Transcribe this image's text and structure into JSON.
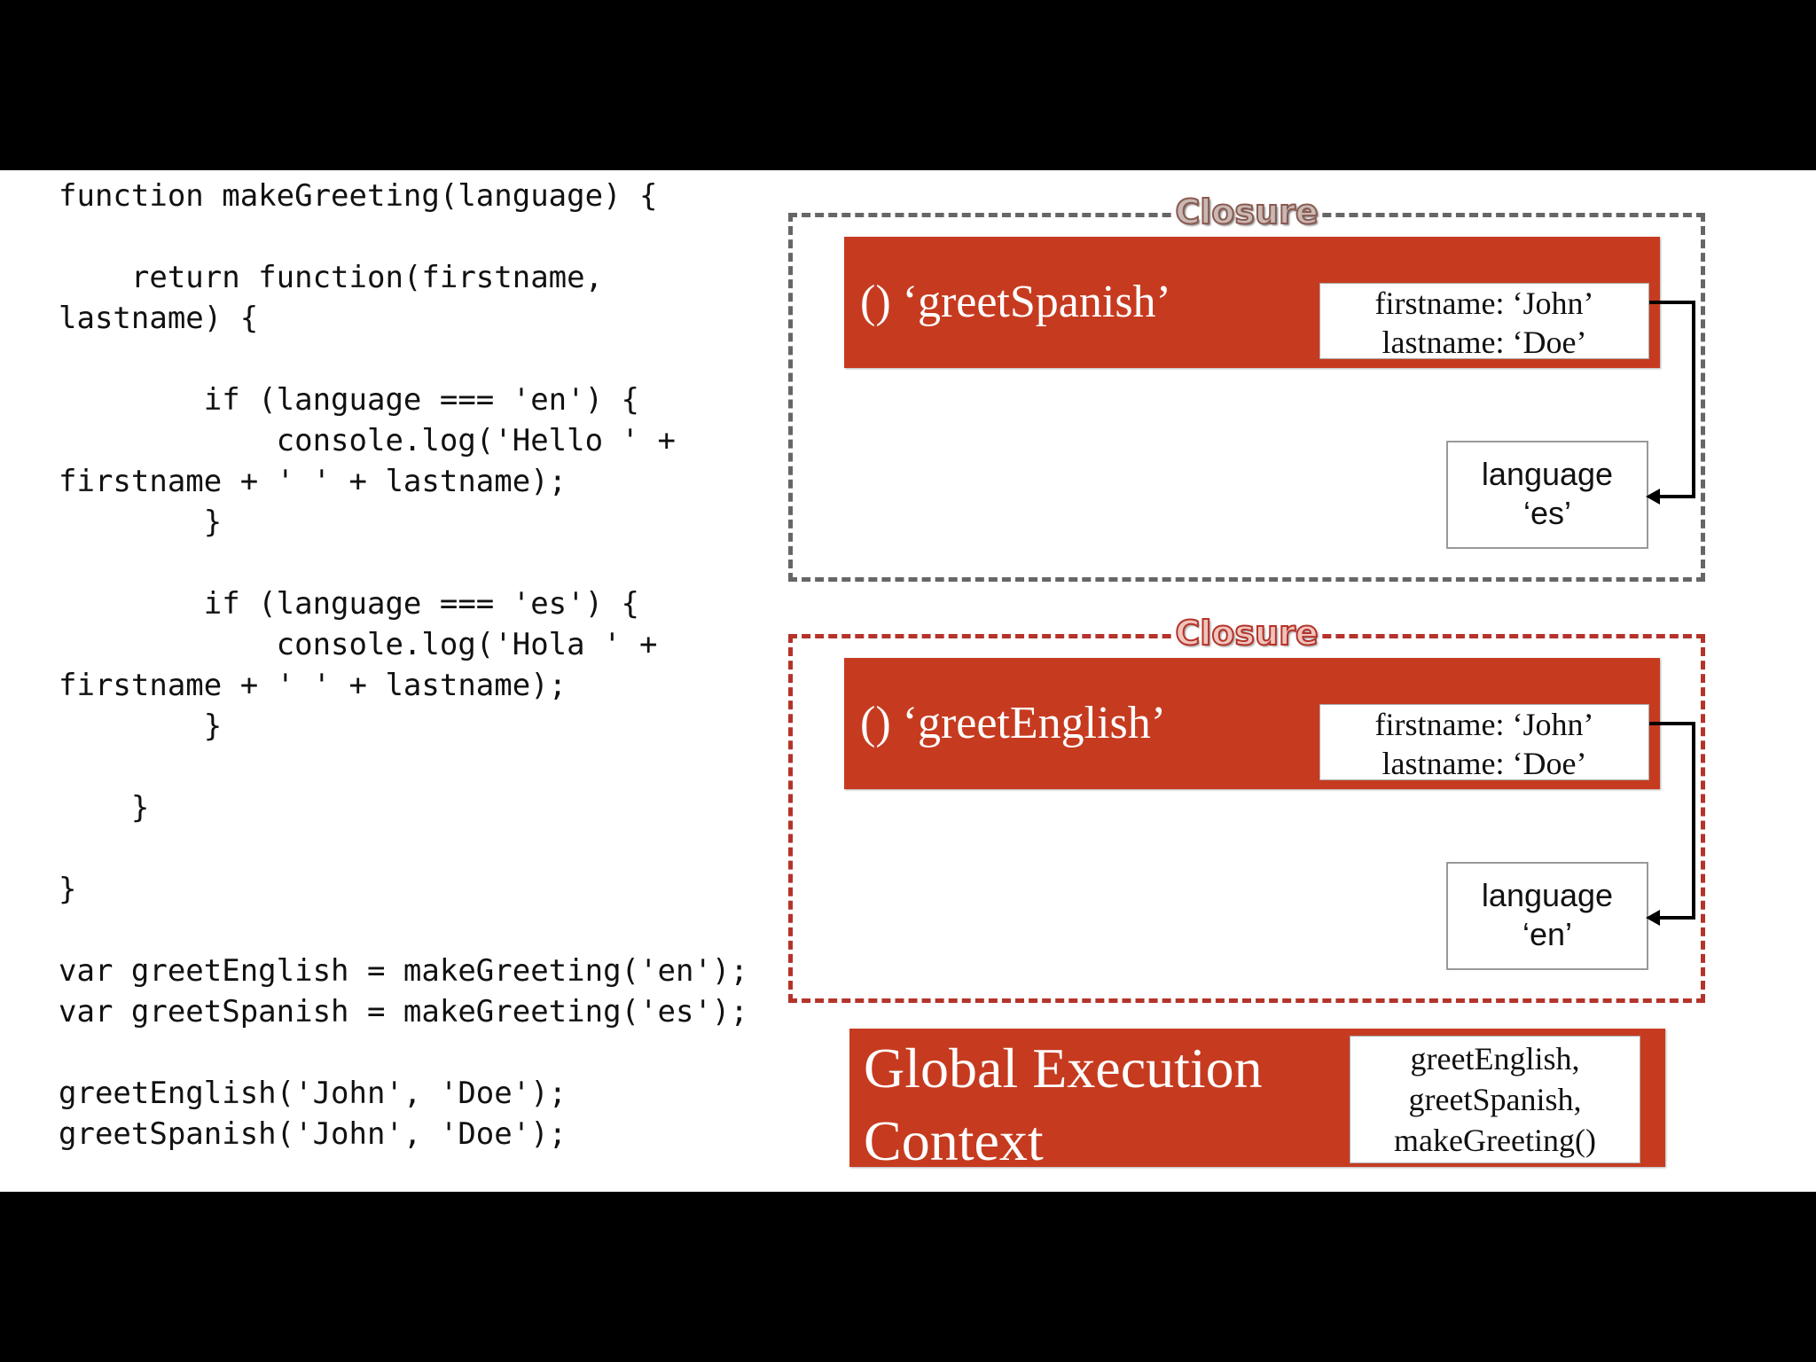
{
  "code": [
    "function makeGreeting(language) {",
    "",
    "    return function(firstname,",
    "lastname) {",
    "",
    "        if (language === 'en') {",
    "            console.log('Hello ' +",
    "firstname + ' ' + lastname);",
    "        }",
    "",
    "        if (language === 'es') {",
    "            console.log('Hola ' +",
    "firstname + ' ' + lastname);",
    "        }",
    "",
    "    }",
    "",
    "}",
    "",
    "var greetEnglish = makeGreeting('en');",
    "var greetSpanish = makeGreeting('es');",
    "",
    "greetEnglish('John', 'Doe');",
    "greetSpanish('John', 'Doe');"
  ],
  "closures": [
    {
      "label": "Closure",
      "function_title": "() ‘greetSpanish’",
      "vars_line1": "firstname: ‘John’",
      "vars_line2": "lastname: ‘Doe’",
      "outer_line1": "language",
      "outer_line2": "‘es’",
      "border_color": "#666666"
    },
    {
      "label": "Closure",
      "function_title": "() ‘greetEnglish’",
      "vars_line1": "firstname: ‘John’",
      "vars_line2": "lastname: ‘Doe’",
      "outer_line1": "language",
      "outer_line2": "‘en’",
      "border_color": "#b5332a"
    }
  ],
  "global": {
    "title_line1": "Global Execution",
    "title_line2": "Context",
    "vars": [
      "greetEnglish,",
      "greetSpanish,",
      "makeGreeting()"
    ]
  },
  "colors": {
    "accent": "#c63b20",
    "closure_red": "#b5332a",
    "closure_gray": "#666666"
  }
}
